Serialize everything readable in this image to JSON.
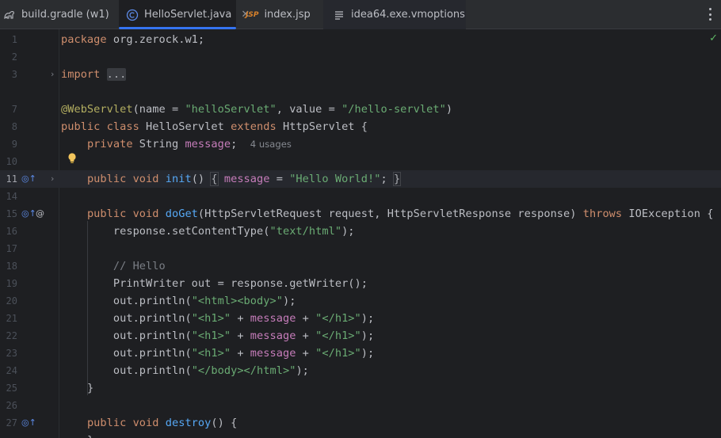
{
  "tabs": [
    {
      "label": "build.gradle (w1)",
      "icon": "gradle-icon"
    },
    {
      "label": "HelloServlet.java",
      "icon": "class-icon",
      "active": true
    },
    {
      "label": "index.jsp",
      "icon": "jsp-icon",
      "prefix": "JSP"
    },
    {
      "label": "idea64.exe.vmoptions",
      "icon": "text-file-icon"
    }
  ],
  "tab_close_glyph": "✕",
  "editor": {
    "line_numbers": [
      "1",
      "2",
      "3",
      "7",
      "8",
      "9",
      "10",
      "11",
      "14",
      "15",
      "16",
      "17",
      "18",
      "19",
      "20",
      "21",
      "22",
      "23",
      "24",
      "25",
      "26",
      "27"
    ],
    "hint_usages": "4 usages",
    "hint_cutoff": "no",
    "folded": "...",
    "lines": {
      "l1_pkg": "package",
      "l1_rest": " org.zerock.w1;",
      "l3_import": "import",
      "l7_ann": "@WebServlet",
      "l7_a": "(name = ",
      "l7_s1": "\"helloServlet\"",
      "l7_b": ", value = ",
      "l7_s2": "\"/hello-servlet\"",
      "l7_c": ")",
      "l8_kw1": "public class",
      "l8_name": " HelloServlet ",
      "l8_kw2": "extends",
      "l8_rest": " HttpServlet {",
      "l9_kw": "private",
      "l9_type": " String ",
      "l9_fld": "message",
      "l9_semi": ";",
      "l11_kw": "public void",
      "l11_fn": "init",
      "l11_paren": "()",
      "l11_open": "{",
      "l11_fld": "message",
      "l11_eq": " = ",
      "l11_str": "\"Hello World!\"",
      "l11_semi": ";",
      "l11_close": "}",
      "l15_kw": "public void",
      "l15_fn": "doGet",
      "l15_params": "(HttpServletRequest request, HttpServletResponse response) ",
      "l15_throws": "throws",
      "l15_rest": " IOException {",
      "l16_a": "response.setContentType(",
      "l16_str": "\"text/html\"",
      "l16_b": ");",
      "l18_cmt": "// Hello",
      "l19": "PrintWriter out = response.getWriter();",
      "l20_a": "out.println(",
      "l20_str": "\"<html><body>\"",
      "l20_b": ");",
      "l21_a": "out.println(",
      "l21_s1": "\"<h1>\"",
      "l21_plus1": " + ",
      "l21_fld": "message",
      "l21_plus2": " + ",
      "l21_s2": "\"</h1>\"",
      "l21_b": ");",
      "l22_a": "out.println(",
      "l22_s1": "\"<h1>\"",
      "l22_plus1": " + ",
      "l22_fld": "message",
      "l22_plus2": " + ",
      "l22_s2": "\"</h1>\"",
      "l22_b": ");",
      "l23_a": "out.println(",
      "l23_s1": "\"<h1>\"",
      "l23_plus1": " + ",
      "l23_fld": "message",
      "l23_plus2": " + ",
      "l23_s2": "\"</h1>\"",
      "l23_b": ");",
      "l24_a": "out.println(",
      "l24_str": "\"</body></html>\"",
      "l24_b": ");",
      "l25": "}",
      "l27_kw": "public void",
      "l27_fn": "destroy",
      "l27_rest": "() {",
      "l28": "}"
    }
  },
  "colors": {
    "keyword": "#cf8e6d",
    "string": "#6aab73",
    "annotation": "#b3ae60",
    "field": "#c77dbb",
    "method": "#56a8f5",
    "accent": "#3574f0"
  }
}
